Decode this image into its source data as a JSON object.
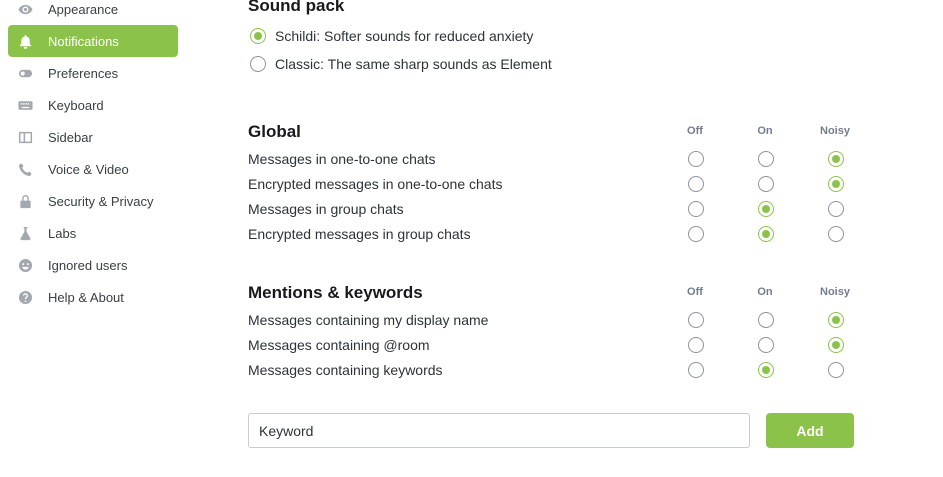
{
  "sidebar": {
    "items": [
      {
        "label": "Appearance",
        "icon": "eye-icon",
        "active": false
      },
      {
        "label": "Notifications",
        "icon": "bell-icon",
        "active": true
      },
      {
        "label": "Preferences",
        "icon": "toggle-icon",
        "active": false
      },
      {
        "label": "Keyboard",
        "icon": "keyboard-icon",
        "active": false
      },
      {
        "label": "Sidebar",
        "icon": "sidebar-icon",
        "active": false
      },
      {
        "label": "Voice & Video",
        "icon": "phone-icon",
        "active": false
      },
      {
        "label": "Security & Privacy",
        "icon": "lock-icon",
        "active": false
      },
      {
        "label": "Labs",
        "icon": "flask-icon",
        "active": false
      },
      {
        "label": "Ignored users",
        "icon": "smiley-icon",
        "active": false
      },
      {
        "label": "Help & About",
        "icon": "help-icon",
        "active": false
      }
    ]
  },
  "sound_pack": {
    "title": "Sound pack",
    "options": [
      {
        "label": "Schildi: Softer sounds for reduced anxiety",
        "selected": true
      },
      {
        "label": "Classic: The same sharp sounds as Element",
        "selected": false
      }
    ]
  },
  "columns": [
    "Off",
    "On",
    "Noisy"
  ],
  "global": {
    "title": "Global",
    "rows": [
      {
        "label": "Messages in one-to-one chats",
        "value": "Noisy"
      },
      {
        "label": "Encrypted messages in one-to-one chats",
        "value": "Noisy"
      },
      {
        "label": "Messages in group chats",
        "value": "On"
      },
      {
        "label": "Encrypted messages in group chats",
        "value": "On"
      }
    ]
  },
  "mentions": {
    "title": "Mentions & keywords",
    "rows": [
      {
        "label": "Messages containing my display name",
        "value": "Noisy"
      },
      {
        "label": "Messages containing @room",
        "value": "Noisy"
      },
      {
        "label": "Messages containing keywords",
        "value": "On"
      }
    ]
  },
  "keyword": {
    "placeholder": "Keyword",
    "add_label": "Add"
  },
  "colors": {
    "accent": "#8bc34a"
  }
}
